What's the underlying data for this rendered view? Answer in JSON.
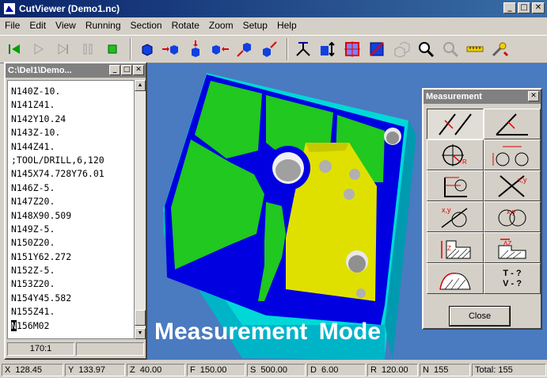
{
  "window": {
    "title": "CutViewer (Demo1.nc)"
  },
  "menu": [
    "File",
    "Edit",
    "View",
    "Running",
    "Section",
    "Rotate",
    "Zoom",
    "Setup",
    "Help"
  ],
  "toolbar": [
    "rewind",
    "step-back",
    "step-forward",
    "pause",
    "run",
    "view-front",
    "view-right",
    "view-top",
    "view-left",
    "view-iso-1",
    "view-iso-2",
    "measure",
    "dimension",
    "section",
    "section-fill",
    "wire",
    "zoom",
    "pan",
    "ruler",
    "tools"
  ],
  "code_window": {
    "title": "C:\\Del1\\Demo...",
    "lines": [
      "N140Z-10.",
      "N141Z41.",
      "N142Y10.24",
      "N143Z-10.",
      "N144Z41.",
      ";TOOL/DRILL,6,120",
      "N145X74.728Y76.01",
      "N146Z-5.",
      "N147Z20.",
      "N148X90.509",
      "N149Z-5.",
      "N150Z20.",
      "N151Y62.272",
      "N152Z-5.",
      "N153Z20.",
      "N154Y45.582",
      "N155Z41.",
      "N156M02"
    ],
    "cursor_char": "N",
    "last_line_rest": "156M02",
    "status": "170:1"
  },
  "viewport": {
    "mode_label": "Measurement  Mode"
  },
  "measurement": {
    "title": "Measurement",
    "buttons": [
      "measure-parallel",
      "measure-angle",
      "measure-radius",
      "measure-hole-distance",
      "measure-corner-point",
      "measure-intersection",
      "measure-line-circle",
      "measure-circle-circle",
      "measure-depth-z",
      "measure-depth-delta-z",
      "measure-area"
    ],
    "tv_label": "T - ?\nV - ?",
    "tv_line1": "T - ?",
    "tv_line2": "V - ?",
    "close_label": "Close"
  },
  "status": {
    "x_label": "X",
    "x": "128.45",
    "y_label": "Y",
    "y": "133.97",
    "z_label": "Z",
    "z": "40.00",
    "f_label": "F",
    "f": "150.00",
    "s_label": "S",
    "s": "500.00",
    "d_label": "D",
    "d": "6.00",
    "r_label": "R",
    "r": "120.00",
    "n_label": "N",
    "n": "155",
    "total": "Total: 155"
  },
  "colors": {
    "background": "#4a7ac0",
    "stock": "#00d8d8",
    "pocket_floor": "#20c820",
    "wall": "#0000e0",
    "island": "#e0e000"
  }
}
